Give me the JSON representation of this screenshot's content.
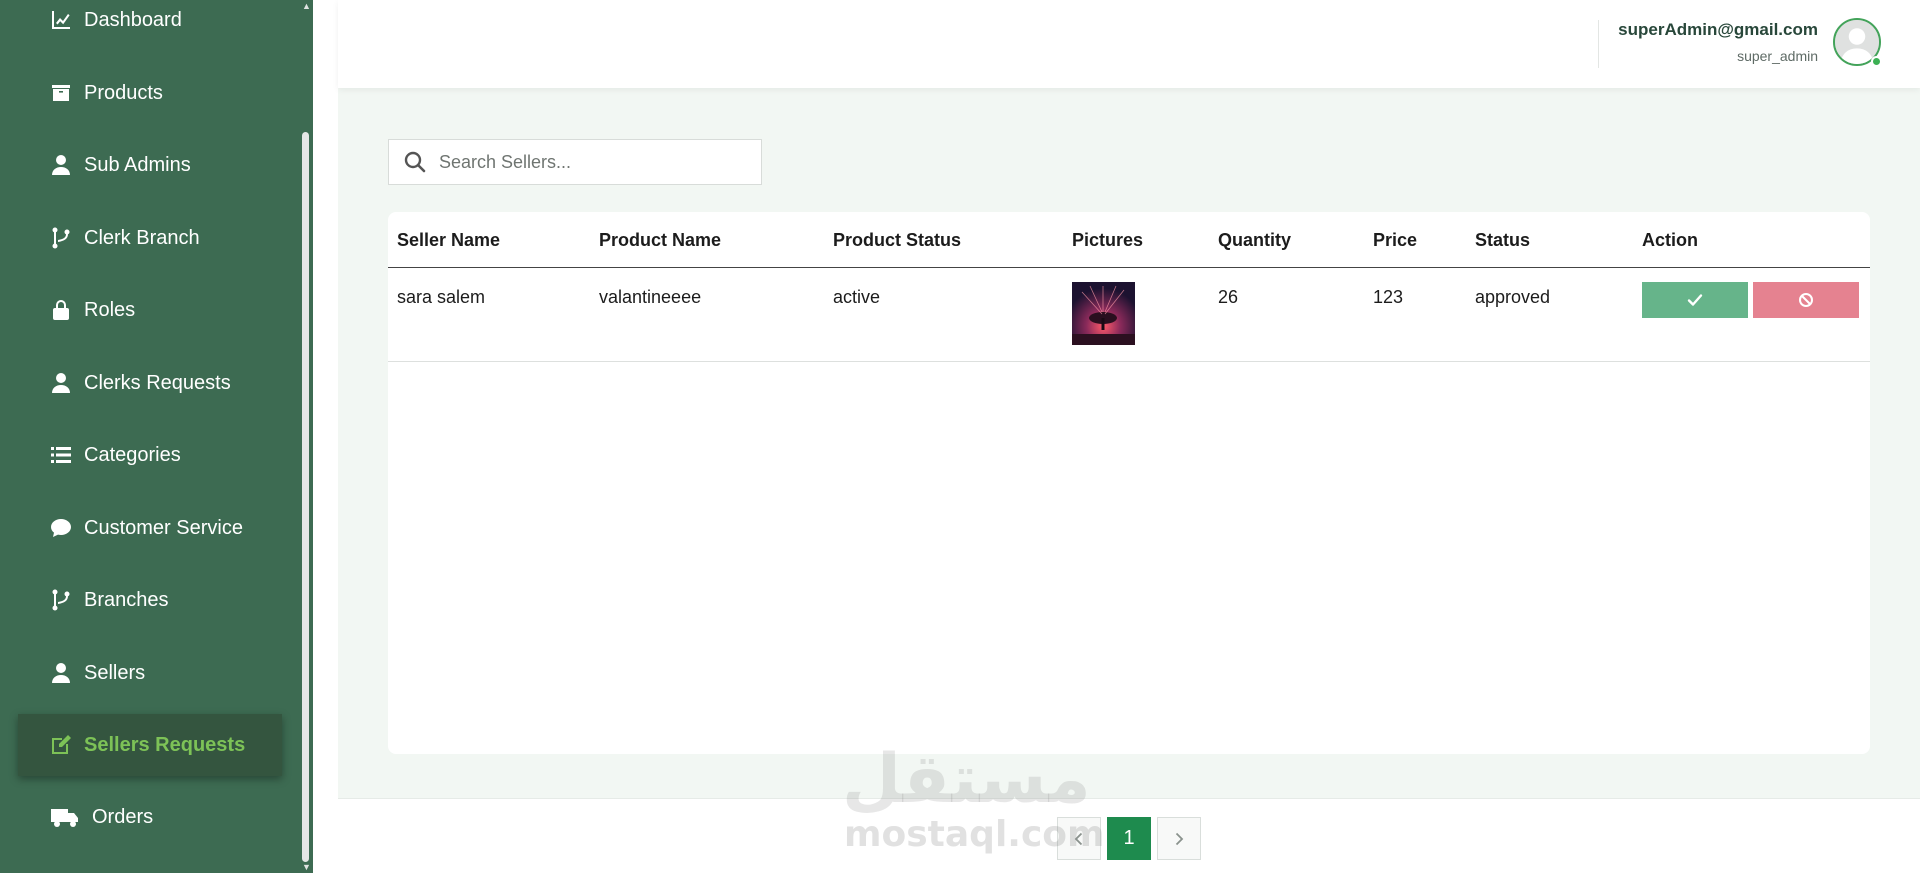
{
  "sidebar": {
    "items": [
      {
        "label": "Dashboard",
        "icon": "chart-line-icon"
      },
      {
        "label": "Products",
        "icon": "box-icon"
      },
      {
        "label": "Sub Admins",
        "icon": "user-tie-icon"
      },
      {
        "label": "Clerk Branch",
        "icon": "code-branch-icon"
      },
      {
        "label": "Roles",
        "icon": "lock-icon"
      },
      {
        "label": "Clerks Requests",
        "icon": "user-tie-icon"
      },
      {
        "label": "Categories",
        "icon": "list-icon"
      },
      {
        "label": "Customer Service",
        "icon": "comment-icon"
      },
      {
        "label": "Branches",
        "icon": "code-branch-icon"
      },
      {
        "label": "Sellers",
        "icon": "user-tie-icon"
      },
      {
        "label": "Sellers Requests",
        "icon": "edit-icon",
        "active": true
      },
      {
        "label": "Orders",
        "icon": "truck-icon"
      }
    ]
  },
  "user": {
    "email": "superAdmin@gmail.com",
    "role": "super_admin"
  },
  "search": {
    "placeholder": "Search Sellers..."
  },
  "table": {
    "columns": [
      "Seller Name",
      "Product Name",
      "Product Status",
      "Pictures",
      "Quantity",
      "Price",
      "Status",
      "Action"
    ],
    "rows": [
      {
        "seller_name": "sara salem",
        "product_name": "valantineeee",
        "product_status": "active",
        "picture": "tree-image",
        "quantity": "26",
        "price": "123",
        "status": "approved"
      }
    ]
  },
  "pagination": {
    "current_page": "1",
    "prev_icon": "chevron-left-icon",
    "next_icon": "chevron-right-icon"
  },
  "watermark": {
    "arabic": "مستقل",
    "latin": "mostaql.com"
  },
  "colors": {
    "sidebar_bg": "#3d6b52",
    "active_text": "#7dc257",
    "approve": "#66b48a",
    "reject": "#e58290",
    "page_active": "#1e8b4e"
  }
}
